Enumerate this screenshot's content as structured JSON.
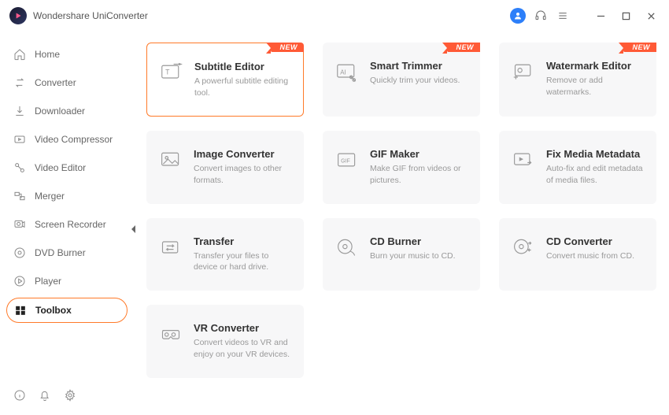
{
  "app": {
    "title": "Wondershare UniConverter"
  },
  "sidebar": {
    "items": [
      {
        "id": "home",
        "label": "Home"
      },
      {
        "id": "converter",
        "label": "Converter"
      },
      {
        "id": "downloader",
        "label": "Downloader"
      },
      {
        "id": "video-compressor",
        "label": "Video Compressor"
      },
      {
        "id": "video-editor",
        "label": "Video Editor"
      },
      {
        "id": "merger",
        "label": "Merger"
      },
      {
        "id": "screen-recorder",
        "label": "Screen Recorder"
      },
      {
        "id": "dvd-burner",
        "label": "DVD Burner"
      },
      {
        "id": "player",
        "label": "Player"
      },
      {
        "id": "toolbox",
        "label": "Toolbox"
      }
    ]
  },
  "toolbox": {
    "badge_label": "NEW",
    "cards": [
      {
        "id": "subtitle-editor",
        "title": "Subtitle Editor",
        "desc": "A powerful subtitle editing tool.",
        "new": true,
        "selected": true
      },
      {
        "id": "smart-trimmer",
        "title": "Smart Trimmer",
        "desc": "Quickly trim your videos.",
        "new": true
      },
      {
        "id": "watermark-editor",
        "title": "Watermark Editor",
        "desc": "Remove or add watermarks.",
        "new": true
      },
      {
        "id": "image-converter",
        "title": "Image Converter",
        "desc": "Convert images to other formats."
      },
      {
        "id": "gif-maker",
        "title": "GIF Maker",
        "desc": "Make GIF from videos or pictures."
      },
      {
        "id": "fix-media-metadata",
        "title": "Fix Media Metadata",
        "desc": "Auto-fix and edit metadata of media files."
      },
      {
        "id": "transfer",
        "title": "Transfer",
        "desc": "Transfer your files to device or hard drive."
      },
      {
        "id": "cd-burner",
        "title": "CD Burner",
        "desc": "Burn your music to CD."
      },
      {
        "id": "cd-converter",
        "title": "CD Converter",
        "desc": "Convert music from CD."
      },
      {
        "id": "vr-converter",
        "title": "VR Converter",
        "desc": "Convert videos to VR and enjoy on your VR devices."
      }
    ]
  }
}
